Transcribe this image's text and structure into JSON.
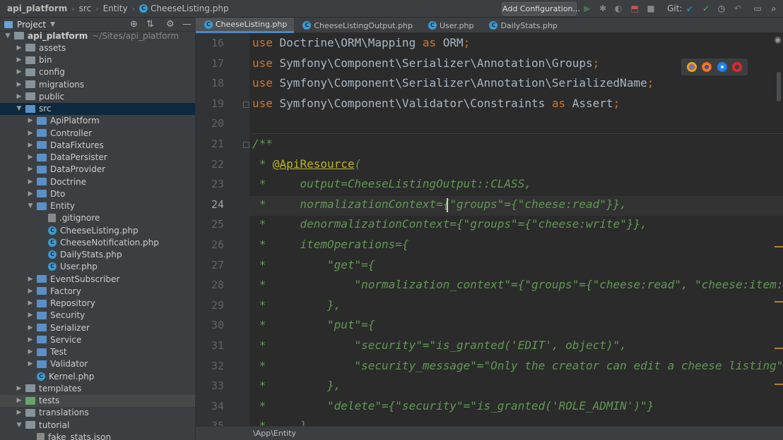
{
  "breadcrumb": [
    {
      "label": "api_platform"
    },
    {
      "label": "src"
    },
    {
      "label": "Entity"
    },
    {
      "label": "CheeseListing.php"
    }
  ],
  "toolbar": {
    "config_label": "Add Configuration...",
    "git_label": "Git:"
  },
  "project": {
    "title": "Project"
  },
  "tree": [
    {
      "label": "api_platform",
      "path": "~/Sites/api_platform",
      "depth": 0,
      "type": "folder",
      "arrow": "down"
    },
    {
      "label": "assets",
      "depth": 1,
      "type": "folder",
      "arrow": "right"
    },
    {
      "label": "bin",
      "depth": 1,
      "type": "folder",
      "arrow": "right"
    },
    {
      "label": "config",
      "depth": 1,
      "type": "folder",
      "arrow": "right"
    },
    {
      "label": "migrations",
      "depth": 1,
      "type": "folder",
      "arrow": "right"
    },
    {
      "label": "public",
      "depth": 1,
      "type": "folder",
      "arrow": "right"
    },
    {
      "label": "src",
      "depth": 1,
      "type": "folder",
      "arrow": "down",
      "state": "selected"
    },
    {
      "label": "ApiPlatform",
      "depth": 2,
      "type": "folder",
      "arrow": "right"
    },
    {
      "label": "Controller",
      "depth": 2,
      "type": "folder",
      "arrow": "right"
    },
    {
      "label": "DataFixtures",
      "depth": 2,
      "type": "folder",
      "arrow": "right"
    },
    {
      "label": "DataPersister",
      "depth": 2,
      "type": "folder",
      "arrow": "right"
    },
    {
      "label": "DataProvider",
      "depth": 2,
      "type": "folder",
      "arrow": "right"
    },
    {
      "label": "Doctrine",
      "depth": 2,
      "type": "folder",
      "arrow": "right"
    },
    {
      "label": "Dto",
      "depth": 2,
      "type": "folder",
      "arrow": "right"
    },
    {
      "label": "Entity",
      "depth": 2,
      "type": "folder",
      "arrow": "down"
    },
    {
      "label": ".gitignore",
      "depth": 3,
      "type": "cfg"
    },
    {
      "label": "CheeseListing.php",
      "depth": 3,
      "type": "php"
    },
    {
      "label": "CheeseNotification.php",
      "depth": 3,
      "type": "php"
    },
    {
      "label": "DailyStats.php",
      "depth": 3,
      "type": "php"
    },
    {
      "label": "User.php",
      "depth": 3,
      "type": "php"
    },
    {
      "label": "EventSubscriber",
      "depth": 2,
      "type": "folder",
      "arrow": "right"
    },
    {
      "label": "Factory",
      "depth": 2,
      "type": "folder",
      "arrow": "right"
    },
    {
      "label": "Repository",
      "depth": 2,
      "type": "folder",
      "arrow": "right"
    },
    {
      "label": "Security",
      "depth": 2,
      "type": "folder",
      "arrow": "right"
    },
    {
      "label": "Serializer",
      "depth": 2,
      "type": "folder",
      "arrow": "right"
    },
    {
      "label": "Service",
      "depth": 2,
      "type": "folder",
      "arrow": "right"
    },
    {
      "label": "Test",
      "depth": 2,
      "type": "folder",
      "arrow": "right"
    },
    {
      "label": "Validator",
      "depth": 2,
      "type": "folder",
      "arrow": "right"
    },
    {
      "label": "Kernel.php",
      "depth": 2,
      "type": "php"
    },
    {
      "label": "templates",
      "depth": 1,
      "type": "folder",
      "arrow": "right"
    },
    {
      "label": "tests",
      "depth": 1,
      "type": "folder",
      "arrow": "right",
      "state": "hl"
    },
    {
      "label": "translations",
      "depth": 1,
      "type": "folder",
      "arrow": "right"
    },
    {
      "label": "tutorial",
      "depth": 1,
      "type": "folder",
      "arrow": "down"
    },
    {
      "label": "fake_stats.json",
      "depth": 2,
      "type": "cfg"
    }
  ],
  "tabs": [
    {
      "label": "CheeseListing.php",
      "active": true
    },
    {
      "label": "CheeseListingOutput.php",
      "active": false
    },
    {
      "label": "User.php",
      "active": false
    },
    {
      "label": "DailyStats.php",
      "active": false
    }
  ],
  "editor": {
    "lines": [
      {
        "n": "16",
        "tokens": [
          [
            "kw",
            "use"
          ],
          [
            "t",
            " Doctrine\\ORM\\Mapping "
          ],
          [
            "kw",
            "as"
          ],
          [
            "t",
            " ORM"
          ],
          [
            "kw",
            ";"
          ]
        ]
      },
      {
        "n": "17",
        "tokens": [
          [
            "kw",
            "use"
          ],
          [
            "t",
            " Symfony\\Component\\Serializer\\Annotation\\Groups"
          ],
          [
            "kw",
            ";"
          ]
        ]
      },
      {
        "n": "18",
        "tokens": [
          [
            "kw",
            "use"
          ],
          [
            "t",
            " Symfony\\Component\\Serializer\\Annotation\\SerializedName"
          ],
          [
            "kw",
            ";"
          ]
        ]
      },
      {
        "n": "19",
        "tokens": [
          [
            "kw",
            "use"
          ],
          [
            "t",
            " Symfony\\Component\\Validator\\Constraints "
          ],
          [
            "kw",
            "as"
          ],
          [
            "t",
            " Assert"
          ],
          [
            "kw",
            ";"
          ]
        ]
      },
      {
        "n": "20",
        "tokens": []
      },
      {
        "n": "21",
        "tokens": [
          [
            "doc",
            "/**"
          ]
        ]
      },
      {
        "n": "22",
        "tokens": [
          [
            "docm",
            " * "
          ],
          [
            "ann",
            "@ApiResource"
          ],
          [
            "doc",
            "("
          ]
        ]
      },
      {
        "n": "23",
        "tokens": [
          [
            "docm",
            " *     "
          ],
          [
            "doc",
            "output=CheeseListingOutput::CLASS,"
          ]
        ]
      },
      {
        "n": "24",
        "tokens": [
          [
            "docm",
            " *     "
          ],
          [
            "doc",
            "normalizationContext={\"groups\"={\"cheese:read\"}},"
          ]
        ]
      },
      {
        "n": "25",
        "tokens": [
          [
            "docm",
            " *     "
          ],
          [
            "doc",
            "denormalizationContext={\"groups\"={\"cheese:write\"}},"
          ]
        ]
      },
      {
        "n": "26",
        "tokens": [
          [
            "docm",
            " *     "
          ],
          [
            "doc",
            "itemOperations={"
          ]
        ]
      },
      {
        "n": "27",
        "tokens": [
          [
            "docm",
            " *         "
          ],
          [
            "doc",
            "\"get\"={"
          ]
        ]
      },
      {
        "n": "28",
        "tokens": [
          [
            "docm",
            " *             "
          ],
          [
            "doc",
            "\"normalization_context\"={\"groups\"={\"cheese:read\", \"cheese:item:get\"}},"
          ]
        ]
      },
      {
        "n": "29",
        "tokens": [
          [
            "docm",
            " *         "
          ],
          [
            "doc",
            "},"
          ]
        ]
      },
      {
        "n": "30",
        "tokens": [
          [
            "docm",
            " *         "
          ],
          [
            "doc",
            "\"put\"={"
          ]
        ]
      },
      {
        "n": "31",
        "tokens": [
          [
            "docm",
            " *             "
          ],
          [
            "doc",
            "\"security\"=\"is_granted('EDIT', object)\","
          ]
        ]
      },
      {
        "n": "32",
        "tokens": [
          [
            "docm",
            " *             "
          ],
          [
            "doc",
            "\"security_message\"=\"Only the creator can edit a cheese listing\""
          ]
        ]
      },
      {
        "n": "33",
        "tokens": [
          [
            "docm",
            " *         "
          ],
          [
            "doc",
            "},"
          ]
        ]
      },
      {
        "n": "34",
        "tokens": [
          [
            "docm",
            " *         "
          ],
          [
            "doc",
            "\"delete\"={\"security\"=\"is_granted('ROLE_ADMIN')\"}"
          ]
        ]
      },
      {
        "n": "35",
        "tokens": [
          [
            "docm",
            " *     "
          ],
          [
            "doc",
            "},"
          ]
        ]
      }
    ],
    "current_line": "24"
  },
  "footer": {
    "namespace": "\\App\\Entity"
  },
  "colors": {
    "accent": "#4a88c7",
    "keyword": "#cc7832",
    "doc": "#629755",
    "annotation": "#bbb529",
    "selection": "#0d293e"
  }
}
